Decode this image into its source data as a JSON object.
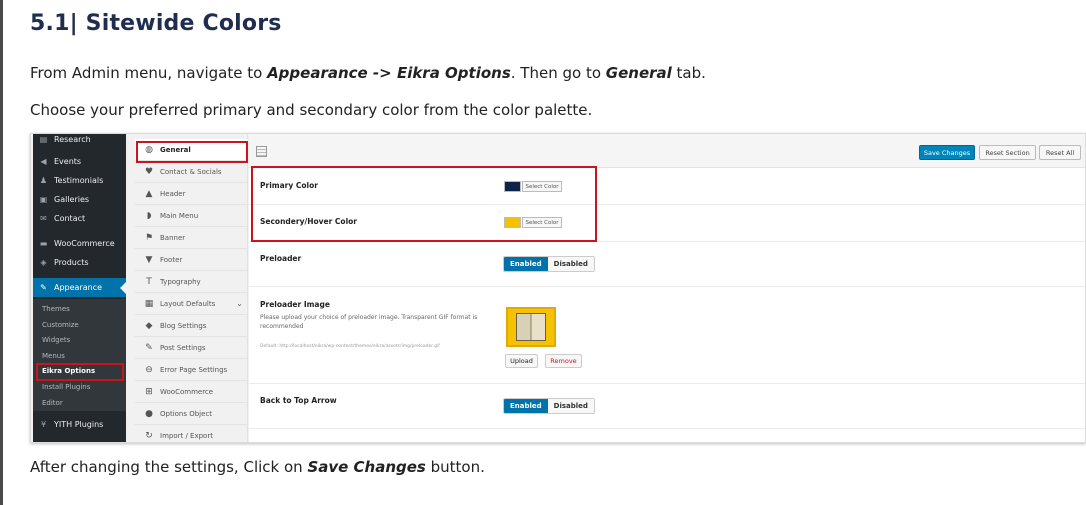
{
  "doc": {
    "title": "5.1| Sitewide Colors",
    "para1_prefix": "From Admin menu, navigate to ",
    "para1_strong1": "Appearance -> Eikra Options",
    "para1_mid": ". Then go to ",
    "para1_strong2": "General",
    "para1_suffix": " tab.",
    "para2": "Choose your preferred primary and secondary color from the color palette.",
    "para3_prefix": "After changing the settings, Click on ",
    "para3_strong": "Save Changes",
    "para3_suffix": " button."
  },
  "wp_menu": {
    "items": [
      {
        "label": "Research",
        "icon": "list-icon"
      },
      {
        "label": "Events",
        "icon": "megaphone-icon"
      },
      {
        "label": "Testimonials",
        "icon": "person-icon"
      },
      {
        "label": "Galleries",
        "icon": "image-icon"
      },
      {
        "label": "Contact",
        "icon": "mail-icon"
      },
      {
        "label": "WooCommerce",
        "icon": "woo-icon"
      },
      {
        "label": "Products",
        "icon": "box-icon"
      },
      {
        "label": "Appearance",
        "icon": "brush-icon"
      },
      {
        "label": "YITH Plugins",
        "icon": "yith-icon"
      }
    ],
    "submenu": [
      "Themes",
      "Customize",
      "Widgets",
      "Menus",
      "Eikra Options",
      "Install Plugins",
      "Editor"
    ]
  },
  "options_sidebar": {
    "items": [
      {
        "label": "General",
        "icon": "globe-icon"
      },
      {
        "label": "Contact & Socials",
        "icon": "twitter-icon"
      },
      {
        "label": "Header",
        "icon": "triangle-up-icon"
      },
      {
        "label": "Main Menu",
        "icon": "shield-icon"
      },
      {
        "label": "Banner",
        "icon": "flag-icon"
      },
      {
        "label": "Footer",
        "icon": "triangle-down-icon"
      },
      {
        "label": "Typography",
        "icon": "text-icon"
      },
      {
        "label": "Layout Defaults",
        "icon": "grid-icon"
      },
      {
        "label": "Blog Settings",
        "icon": "tag-icon"
      },
      {
        "label": "Post Settings",
        "icon": "edit-icon"
      },
      {
        "label": "Error Page Settings",
        "icon": "minus-circle-icon"
      },
      {
        "label": "WooCommerce",
        "icon": "cart-icon"
      },
      {
        "label": "Options Object",
        "icon": "info-icon"
      },
      {
        "label": "Import / Export",
        "icon": "refresh-icon"
      }
    ]
  },
  "toolbar": {
    "save_label": "Save Changes",
    "reset_section_label": "Reset Section",
    "reset_all_label": "Reset All"
  },
  "fields": {
    "primary_color_label": "Primary Color",
    "primary_color_value": "#0f2248",
    "secondary_color_label": "Secondery/Hover Color",
    "secondary_color_value": "#f5c000",
    "select_color_label": "Select Color",
    "preloader_label": "Preloader",
    "preloader_image_label": "Preloader Image",
    "preloader_image_desc": "Please upload your choice of preloader image. Transparent GIF format is recommended",
    "preloader_default": "Default: http://localhost/eikra/wp-content/themes/eikra/assets/img/preloader.gif",
    "upload_label": "Upload",
    "remove_label": "Remove",
    "back_to_top_label": "Back to Top Arrow",
    "enabled_label": "Enabled",
    "disabled_label": "Disabled"
  },
  "colors": {
    "heading": "#1f2d4e",
    "highlight_red": "#c9151e",
    "wp_active": "#0073aa"
  }
}
